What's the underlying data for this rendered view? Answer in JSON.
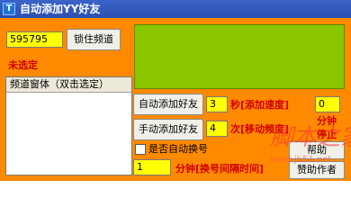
{
  "window": {
    "title": "自动添加YY好友",
    "icon": "app-icon"
  },
  "channel": {
    "value": "595795",
    "lock_button": "锁住频道",
    "status": "未选定"
  },
  "list": {
    "header": "频道窗体（双击选定）"
  },
  "actions": {
    "auto_add": "自动添加好友",
    "manual_add": "手动添加好友",
    "speed_value": "3",
    "speed_label": "秒[添加速度]",
    "count_value": "4",
    "count_label": "次[移动频度]",
    "stop_value": "0",
    "stop_label_1": "分钟",
    "stop_label_2": "停止",
    "auto_switch": "是否自动换号",
    "interval_value": "1",
    "interval_label": "分钟[换号间隔时间]",
    "help": "帮助",
    "sponsor": "赞助作者"
  },
  "watermark": {
    "text": "脚本之家",
    "url": "www.jb51.net"
  },
  "colors": {
    "background": "#ff8a00",
    "input": "#ffff00",
    "panel": "#8ac600",
    "label": "#d00000"
  }
}
